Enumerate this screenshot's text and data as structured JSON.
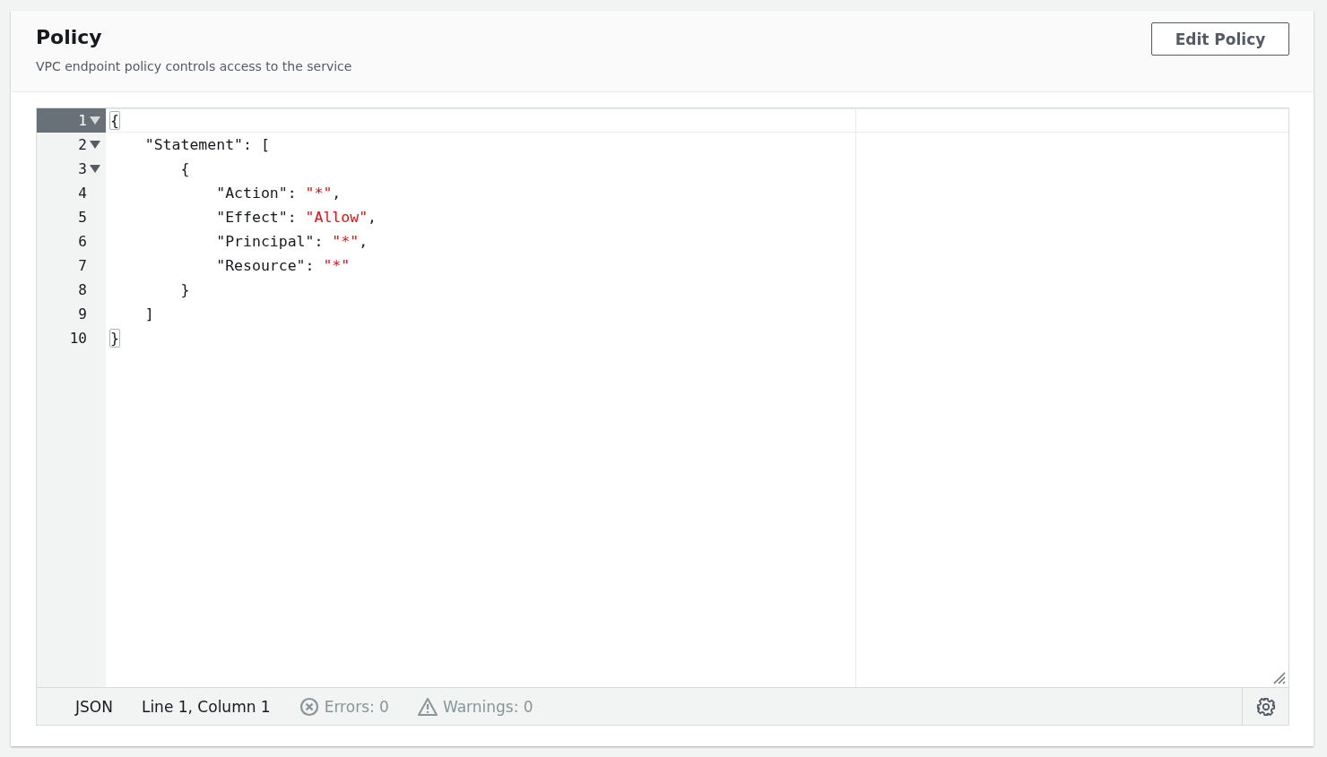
{
  "header": {
    "title": "Policy",
    "description": "VPC endpoint policy controls access to the service",
    "button": "Edit Policy"
  },
  "editor": {
    "lines": [
      {
        "number": "1",
        "foldable": true,
        "active": true,
        "tokens": [
          {
            "kind": "bracket-match",
            "text": "{"
          }
        ]
      },
      {
        "number": "2",
        "foldable": true,
        "active": false,
        "tokens": [
          {
            "kind": "plain",
            "text": "    \"Statement\": ["
          }
        ]
      },
      {
        "number": "3",
        "foldable": true,
        "active": false,
        "tokens": [
          {
            "kind": "plain",
            "text": "        {"
          }
        ]
      },
      {
        "number": "4",
        "foldable": false,
        "active": false,
        "tokens": [
          {
            "kind": "plain",
            "text": "            \"Action\": "
          },
          {
            "kind": "string",
            "text": "\"*\""
          },
          {
            "kind": "plain",
            "text": ","
          }
        ]
      },
      {
        "number": "5",
        "foldable": false,
        "active": false,
        "tokens": [
          {
            "kind": "plain",
            "text": "            \"Effect\": "
          },
          {
            "kind": "string",
            "text": "\"Allow\""
          },
          {
            "kind": "plain",
            "text": ","
          }
        ]
      },
      {
        "number": "6",
        "foldable": false,
        "active": false,
        "tokens": [
          {
            "kind": "plain",
            "text": "            \"Principal\": "
          },
          {
            "kind": "string",
            "text": "\"*\""
          },
          {
            "kind": "plain",
            "text": ","
          }
        ]
      },
      {
        "number": "7",
        "foldable": false,
        "active": false,
        "tokens": [
          {
            "kind": "plain",
            "text": "            \"Resource\": "
          },
          {
            "kind": "string",
            "text": "\"*\""
          }
        ]
      },
      {
        "number": "8",
        "foldable": false,
        "active": false,
        "tokens": [
          {
            "kind": "plain",
            "text": "        }"
          }
        ]
      },
      {
        "number": "9",
        "foldable": false,
        "active": false,
        "tokens": [
          {
            "kind": "plain",
            "text": "    ]"
          }
        ]
      },
      {
        "number": "10",
        "foldable": false,
        "active": false,
        "tokens": [
          {
            "kind": "bracket-match",
            "text": "}"
          }
        ]
      }
    ],
    "status_bar": {
      "mode": "JSON",
      "position": "Line 1, Column 1",
      "errors": "Errors: 0",
      "warnings": "Warnings: 0"
    }
  }
}
